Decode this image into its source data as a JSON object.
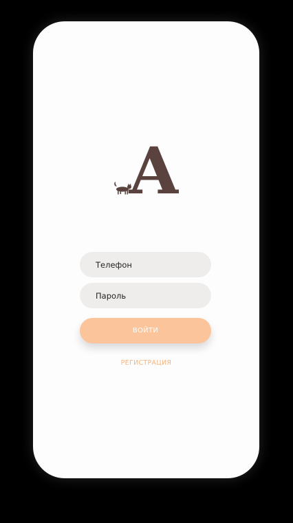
{
  "login_form": {
    "phone_placeholder": "Телефон",
    "password_placeholder": "Пароль",
    "login_button_label": "ВОЙТИ",
    "register_link_label": "РЕГИСТРАЦИЯ"
  },
  "logo": {
    "letter": "A",
    "icon": "cat-icon"
  },
  "colors": {
    "logo_brown": "#5a433f",
    "accent_peach": "#fcc49a",
    "link_orange": "#f6b47e",
    "field_gray": "#efecec"
  }
}
